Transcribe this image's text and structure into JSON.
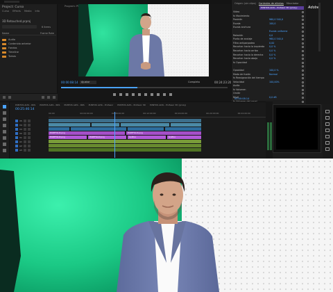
{
  "app": {
    "accent": "#4aa3ff",
    "label_color": "#8c4fd6"
  },
  "project": {
    "title": "Project: Curso",
    "tabs": [
      "Curso",
      "Effects",
      "Media",
      "Info"
    ],
    "name": "3D Retouched.prproj",
    "count": "6 items",
    "col_name": "Name",
    "col_rate": "Frame Rate",
    "bins": [
      "Audio",
      "Contenido anterior",
      "Fondos",
      "Timeline",
      "Tomas"
    ]
  },
  "program": {
    "title": "Program: PUNTOS ALTA - Profesor 3D Recorte",
    "timecode_left": "00:00:08:14",
    "fit": "Ajustar",
    "quality": "Completa",
    "timecode_right": "00:24:23:20"
  },
  "effects": {
    "tabs": [
      "Origen: (sin clips)",
      "Controles de efectos",
      "Mezclador"
    ],
    "clip_label": "PUNTOS ALTA - Profesor 3D (proxy)",
    "rows": [
      {
        "label": "Vídeo",
        "value": ""
      },
      {
        "label": "fx Movimiento",
        "value": ""
      },
      {
        "label": "  Posición",
        "value": "960,0  540,0"
      },
      {
        "label": "  Escala",
        "value": "100,0"
      },
      {
        "label": "  Escala anchura",
        "value": ""
      },
      {
        "label": "",
        "value": "Escala uniforme"
      },
      {
        "label": "  Rotación",
        "value": "0,0"
      },
      {
        "label": "  Punto de anclaje",
        "value": "960,0  540,0"
      },
      {
        "label": "  Filtro antiparpadeo",
        "value": "0,00"
      },
      {
        "label": "  Recortar: hacia la izquierda",
        "value": "0,0 %"
      },
      {
        "label": "  Recortar: hacia arriba",
        "value": "0,0 %"
      },
      {
        "label": "  Recortar: hacia la derecha",
        "value": "0,0 %"
      },
      {
        "label": "  Recortar: hacia abajo",
        "value": "0,0 %"
      },
      {
        "label": "fx Opacidad",
        "value": ""
      },
      {
        "label": "",
        "value": ""
      },
      {
        "label": "  Opacidad",
        "value": "100,0 %"
      },
      {
        "label": "  Modo de fusión",
        "value": "Normal"
      },
      {
        "label": "fx Reasignación del tiempo",
        "value": ""
      },
      {
        "label": "  Velocidad",
        "value": "100,00%"
      },
      {
        "label": "Audio",
        "value": ""
      },
      {
        "label": "fx Volumen",
        "value": ""
      },
      {
        "label": "  Omitir",
        "value": ""
      },
      {
        "label": "  Nivel",
        "value": "0,0 dB"
      },
      {
        "label": "fx Volumen del canal",
        "value": ""
      },
      {
        "label": "fx Panoramizador",
        "value": ""
      },
      {
        "label": "fx Volumen (1)",
        "value": ""
      },
      {
        "label": "  Mezcla de volumen",
        "value": ""
      }
    ],
    "timecode": "00:00:08:14"
  },
  "rstrip": {
    "logo": "Adobe"
  },
  "timeline": {
    "tabs": [
      "PUNTOS ALTA - RKS",
      "PUNTOS ALTA - RKS",
      "PUNTOS ALTA - RKS",
      "PUNTOS ALTA - Profesor",
      "PUNTOS ALTA - Profesor 3D",
      "PUNTOS ALTA - Profesor 3D (proxy)"
    ],
    "timecode": "00:25:46:14",
    "ruler": [
      "00:00",
      "00:04:00:00",
      "00:08:00:00",
      "00:12:00:00",
      "00:16:00:00",
      "00:20:00:00",
      "00:24:00:00"
    ],
    "tracks": [
      "V5",
      "V4",
      "V3",
      "V2",
      "V1",
      "A1",
      "A2",
      "A3"
    ],
    "clip_labels": [
      "PORTFOLIO.png",
      "PORTFOLIO.png",
      "PORTFOLIO.png",
      "PORTFOLIO.png",
      "Gráfico",
      "Gráfico",
      "Gráfico",
      "Gráfico"
    ]
  }
}
